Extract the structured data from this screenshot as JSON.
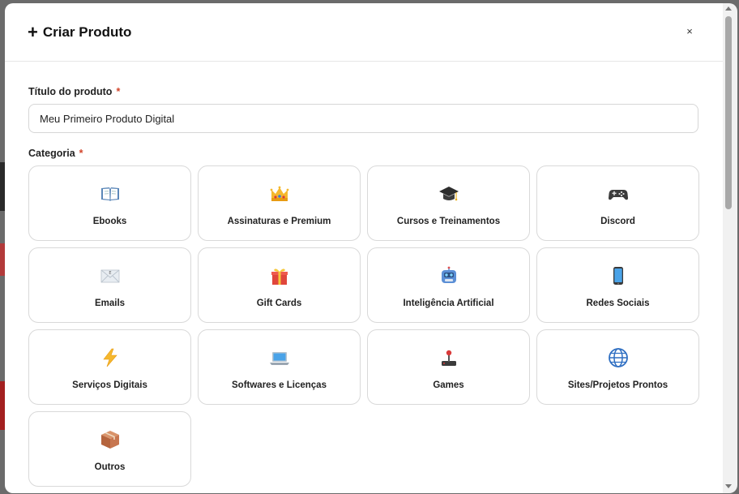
{
  "modal": {
    "title": "Criar Produto",
    "close_label": "×"
  },
  "form": {
    "title_label": "Título do produto",
    "title_value": "Meu Primeiro Produto Digital",
    "category_label": "Categoria",
    "required_mark": "*"
  },
  "categories": [
    {
      "label": "Ebooks",
      "icon": "book-icon"
    },
    {
      "label": "Assinaturas e Premium",
      "icon": "crown-icon"
    },
    {
      "label": "Cursos e Treinamentos",
      "icon": "graduation-cap-icon"
    },
    {
      "label": "Discord",
      "icon": "gamepad-icon"
    },
    {
      "label": "Emails",
      "icon": "envelope-icon"
    },
    {
      "label": "Gift Cards",
      "icon": "gift-icon"
    },
    {
      "label": "Inteligência Artificial",
      "icon": "robot-icon"
    },
    {
      "label": "Redes Sociais",
      "icon": "phone-icon"
    },
    {
      "label": "Serviços Digitais",
      "icon": "lightning-icon"
    },
    {
      "label": "Softwares e Licenças",
      "icon": "laptop-icon"
    },
    {
      "label": "Games",
      "icon": "joystick-icon"
    },
    {
      "label": "Sites/Projetos Prontos",
      "icon": "globe-icon"
    },
    {
      "label": "Outros",
      "icon": "package-icon"
    }
  ],
  "colors": {
    "required": "#d2452b",
    "border": "#d9d9d9"
  }
}
